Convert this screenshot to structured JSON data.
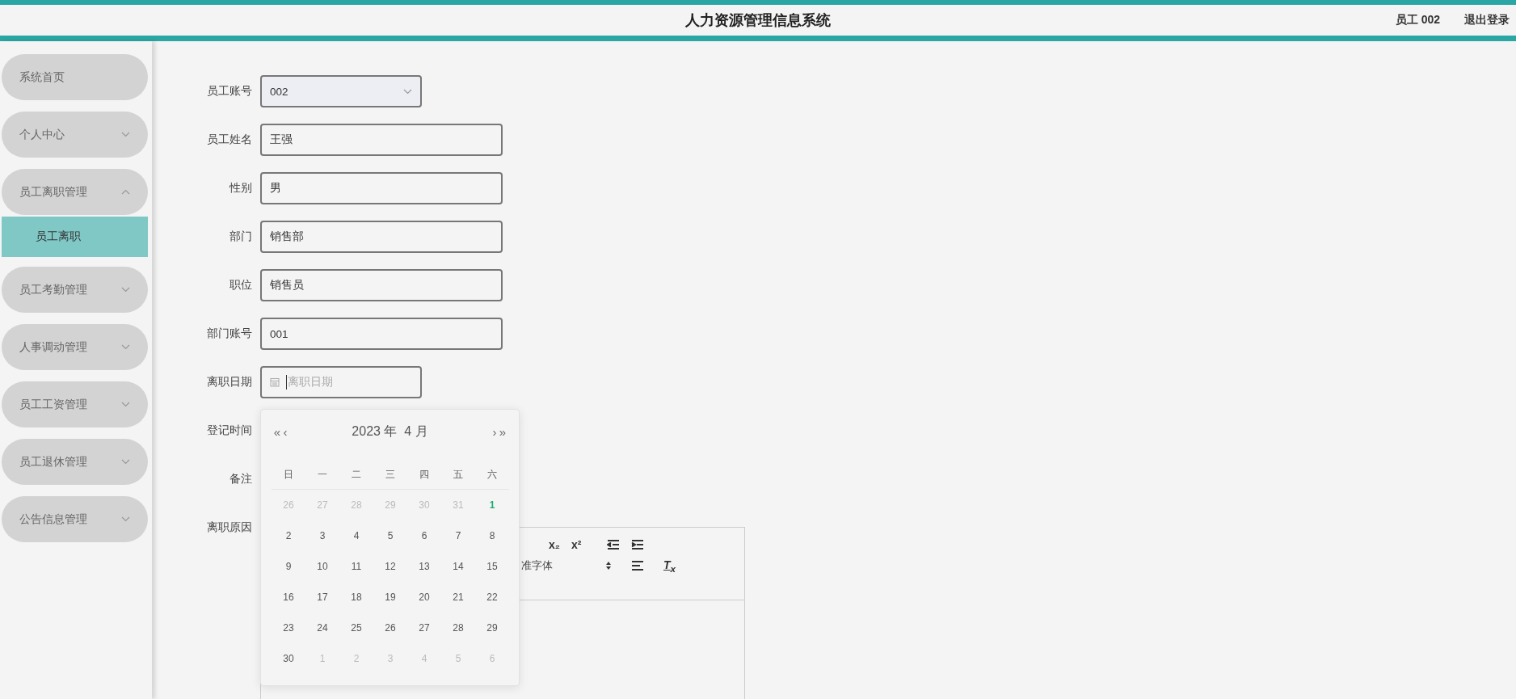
{
  "header": {
    "title": "人力资源管理信息系统",
    "user": "员工 002",
    "logout": "退出登录"
  },
  "sidebar": {
    "items": [
      {
        "label": "系统首页",
        "kind": "link"
      },
      {
        "label": "个人中心",
        "kind": "menu",
        "expanded": false
      },
      {
        "label": "员工离职管理",
        "kind": "menu",
        "expanded": true,
        "children": [
          {
            "label": "员工离职",
            "selected": true
          }
        ]
      },
      {
        "label": "员工考勤管理",
        "kind": "menu",
        "expanded": false
      },
      {
        "label": "人事调动管理",
        "kind": "menu",
        "expanded": false
      },
      {
        "label": "员工工资管理",
        "kind": "menu",
        "expanded": false
      },
      {
        "label": "员工退休管理",
        "kind": "menu",
        "expanded": false
      },
      {
        "label": "公告信息管理",
        "kind": "menu",
        "expanded": false
      }
    ]
  },
  "form": {
    "fields": [
      {
        "label": "员工账号",
        "kind": "select",
        "value": "002"
      },
      {
        "label": "员工姓名",
        "kind": "text",
        "value": "王强"
      },
      {
        "label": "性别",
        "kind": "text",
        "value": "男"
      },
      {
        "label": "部门",
        "kind": "text",
        "value": "销售部"
      },
      {
        "label": "职位",
        "kind": "text",
        "value": "销售员"
      },
      {
        "label": "部门账号",
        "kind": "text",
        "value": "001"
      },
      {
        "label": "离职日期",
        "kind": "date",
        "placeholder": "离职日期"
      },
      {
        "label": "登记时间",
        "kind": "hidden"
      },
      {
        "label": "备注",
        "kind": "hidden"
      },
      {
        "label": "离职原因",
        "kind": "editor"
      }
    ]
  },
  "editor": {
    "toolbar": [
      [
        {
          "kind": "text",
          "label": "x₂"
        },
        {
          "kind": "text",
          "label": "x²"
        },
        {
          "kind": "outdent"
        },
        {
          "kind": "indent"
        }
      ],
      [
        {
          "kind": "font",
          "label": "准字体"
        },
        {
          "kind": "updown"
        },
        {
          "kind": "align"
        },
        {
          "kind": "text",
          "label": "T$_{x}$"
        }
      ]
    ]
  },
  "date_picker": {
    "prev_year": "«",
    "prev_month": "‹",
    "title": "2023 年  4 月",
    "next_month": "›",
    "next_year": "»",
    "weekdays": [
      "日",
      "一",
      "二",
      "三",
      "四",
      "五",
      "六"
    ],
    "weeks": [
      [
        {
          "day": "26",
          "kind": "other"
        },
        {
          "day": "27",
          "kind": "other"
        },
        {
          "day": "28",
          "kind": "other"
        },
        {
          "day": "29",
          "kind": "other"
        },
        {
          "day": "30",
          "kind": "other"
        },
        {
          "day": "31",
          "kind": "other"
        },
        {
          "day": "1",
          "kind": "today"
        }
      ],
      [
        {
          "day": "2",
          "kind": "current"
        },
        {
          "day": "3",
          "kind": "current"
        },
        {
          "day": "4",
          "kind": "current"
        },
        {
          "day": "5",
          "kind": "current"
        },
        {
          "day": "6",
          "kind": "current"
        },
        {
          "day": "7",
          "kind": "current"
        },
        {
          "day": "8",
          "kind": "current"
        }
      ],
      [
        {
          "day": "9",
          "kind": "current"
        },
        {
          "day": "10",
          "kind": "current"
        },
        {
          "day": "11",
          "kind": "current"
        },
        {
          "day": "12",
          "kind": "current"
        },
        {
          "day": "13",
          "kind": "current"
        },
        {
          "day": "14",
          "kind": "current"
        },
        {
          "day": "15",
          "kind": "current"
        }
      ],
      [
        {
          "day": "16",
          "kind": "current"
        },
        {
          "day": "17",
          "kind": "current"
        },
        {
          "day": "18",
          "kind": "current"
        },
        {
          "day": "19",
          "kind": "current"
        },
        {
          "day": "20",
          "kind": "current"
        },
        {
          "day": "21",
          "kind": "current"
        },
        {
          "day": "22",
          "kind": "current"
        }
      ],
      [
        {
          "day": "23",
          "kind": "current"
        },
        {
          "day": "24",
          "kind": "current"
        },
        {
          "day": "25",
          "kind": "current"
        },
        {
          "day": "26",
          "kind": "current"
        },
        {
          "day": "27",
          "kind": "current"
        },
        {
          "day": "28",
          "kind": "current"
        },
        {
          "day": "29",
          "kind": "current"
        }
      ],
      [
        {
          "day": "30",
          "kind": "current"
        },
        {
          "day": "1",
          "kind": "other"
        },
        {
          "day": "2",
          "kind": "other"
        },
        {
          "day": "3",
          "kind": "other"
        },
        {
          "day": "4",
          "kind": "other"
        },
        {
          "day": "5",
          "kind": "other"
        },
        {
          "day": "6",
          "kind": "other"
        }
      ]
    ]
  }
}
